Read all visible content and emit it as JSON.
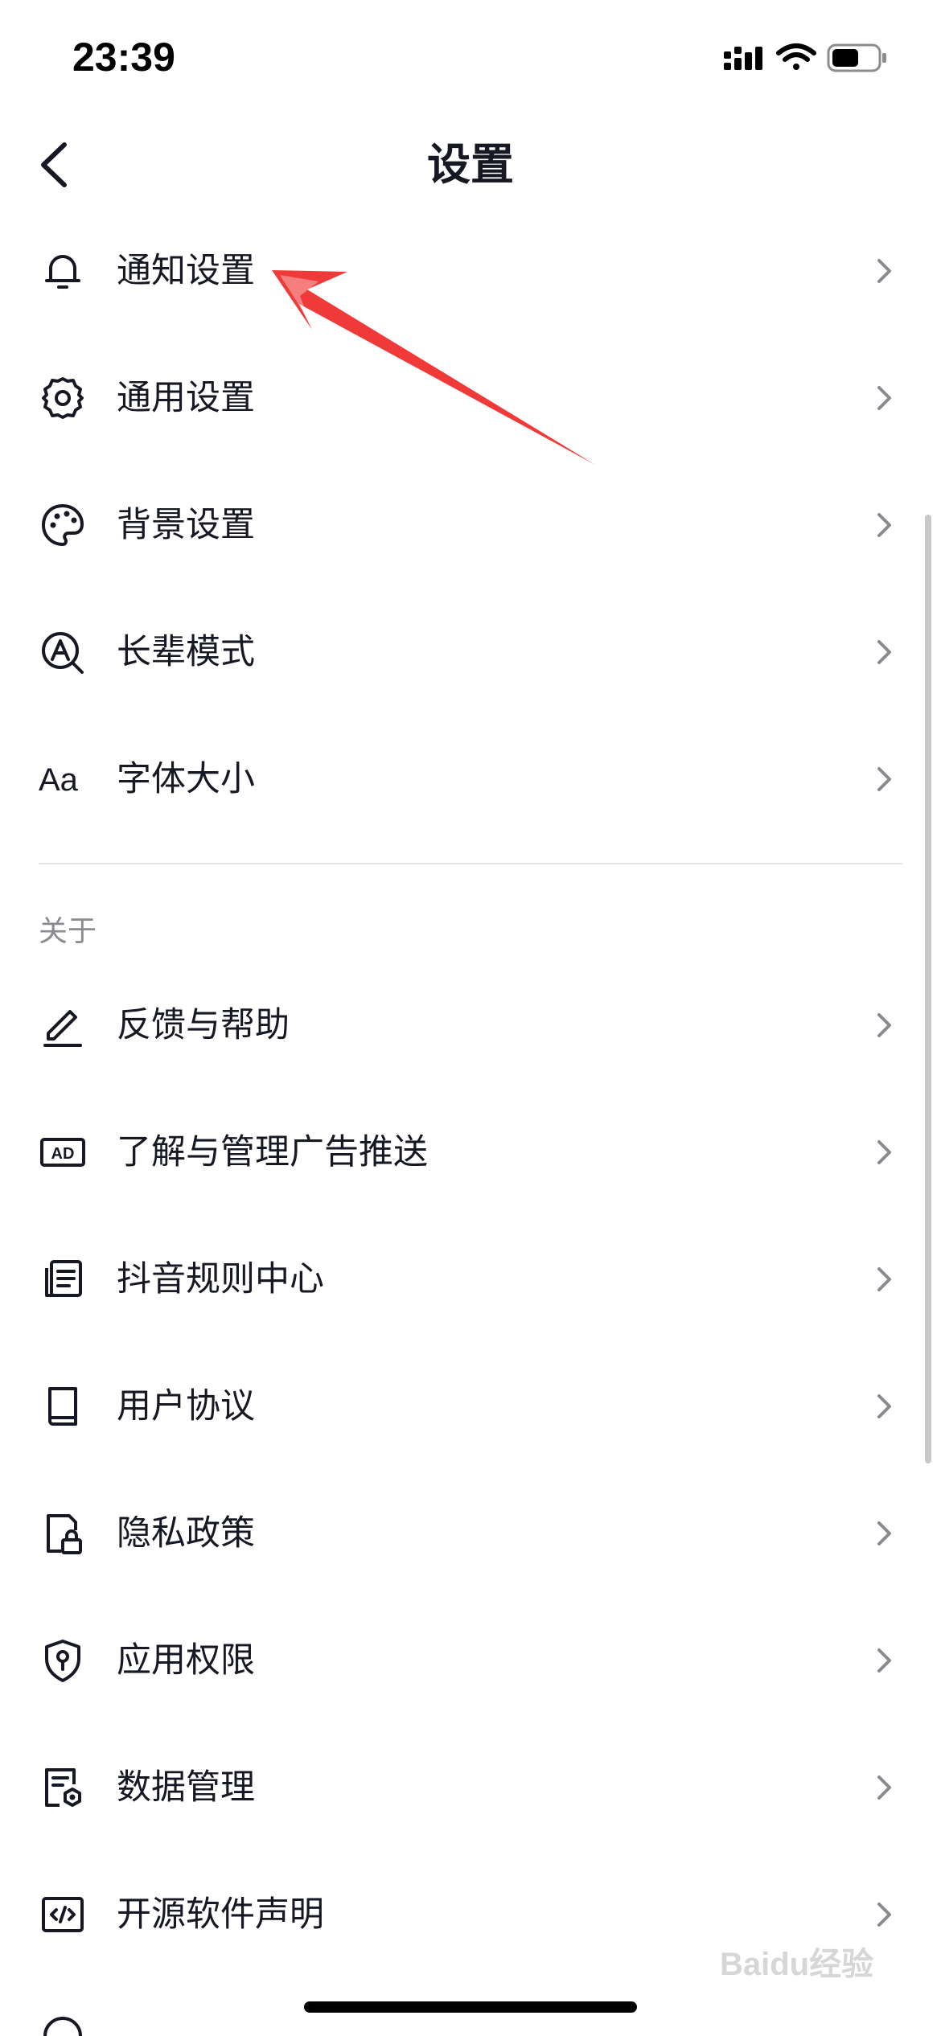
{
  "status_bar": {
    "time": "23:39",
    "icons": [
      "signal-icon",
      "wifi-icon",
      "battery-icon"
    ]
  },
  "nav": {
    "title": "设置",
    "back_icon": "back-chevron-icon"
  },
  "settings_items": [
    {
      "label": "通知设置",
      "icon": "bell-icon"
    },
    {
      "label": "通用设置",
      "icon": "gear-icon"
    },
    {
      "label": "背景设置",
      "icon": "palette-icon"
    },
    {
      "label": "长辈模式",
      "icon": "elder-mode-icon"
    },
    {
      "label": "字体大小",
      "icon": "font-size-icon",
      "icon_text": "Aa"
    }
  ],
  "about": {
    "header": "关于",
    "items": [
      {
        "label": "反馈与帮助",
        "icon": "pencil-icon"
      },
      {
        "label": "了解与管理广告推送",
        "icon": "ad-icon",
        "icon_text": "AD"
      },
      {
        "label": "抖音规则中心",
        "icon": "document-list-icon"
      },
      {
        "label": "用户协议",
        "icon": "book-icon"
      },
      {
        "label": "隐私政策",
        "icon": "file-lock-icon"
      },
      {
        "label": "应用权限",
        "icon": "shield-key-icon"
      },
      {
        "label": "数据管理",
        "icon": "data-settings-icon"
      },
      {
        "label": "开源软件声明",
        "icon": "code-icon"
      }
    ]
  },
  "colors": {
    "text": "#161823",
    "secondary": "#8a8b91",
    "divider": "#e6e6e8",
    "annotation_arrow": "#f03a3a"
  },
  "watermark": "Baidu经验"
}
